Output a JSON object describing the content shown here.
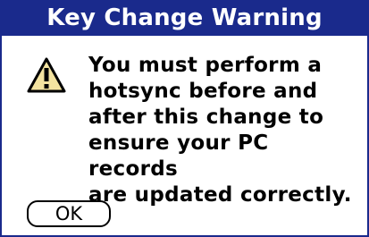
{
  "dialog": {
    "title": "Key Change Warning",
    "icon": "warning-icon",
    "message": "You must perform a\nhotsync before and\nafter this change to\nensure your PC records\nare updated correctly.",
    "ok_label": "OK"
  },
  "colors": {
    "titlebar": "#1a2a8c",
    "warning_fill": "#f3e3a0"
  }
}
